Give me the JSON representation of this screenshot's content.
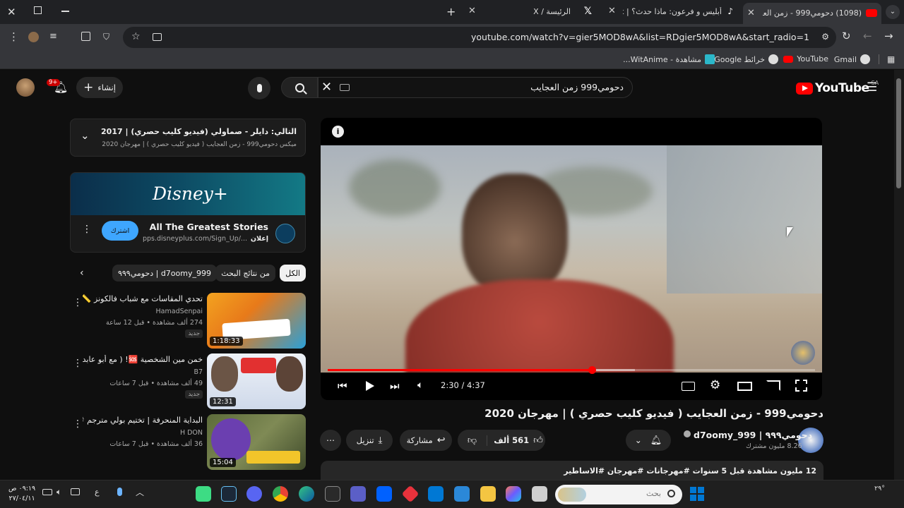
{
  "browser": {
    "tabs": [
      {
        "title": "(1098) دحومي999 - زمن العجايب",
        "active": true
      },
      {
        "title": "أبليس و فرعون: ماذا حدث؟ | TikTok",
        "active": false
      },
      {
        "title": "الرئيسة / X",
        "active": false
      }
    ],
    "url": "youtube.com/watch?v=gier5MOD8wA&list=RDgier5MOD8wA&start_radio=1",
    "bookmarks": [
      "Gmail",
      "YouTube",
      "خرائط Google",
      "مشاهدة - WitAnime..."
    ]
  },
  "youtube": {
    "logo_text": "YouTube",
    "region": "SA",
    "search_query": "دحومي999 زمن العجايب",
    "create_label": "إنشاء",
    "notif_count": "9+"
  },
  "player": {
    "current_time": "2:30",
    "duration": "4:37",
    "progress_fraction": 0.542,
    "buffered_fraction": 0.63
  },
  "video": {
    "title": "دحومي999 - زمن العجايب ( فيديو كليب حصري ) | مهرجان 2020",
    "channel": "d7oomy_999 | دحومي٩٩٩",
    "subscribers": "8.26 مليون مشترك",
    "likes": "561 ألف",
    "share_label": "مشاركة",
    "download_label": "تنزيل",
    "desc_line": "12 مليون مشاهدة  قبل 5 سنوات  #مهرجانات #مهرجان #الاساطير"
  },
  "queue": {
    "next_label": "التالي: دايلر - صماولي (فيديو كليب حصري) | 2017",
    "mix_label": "ميكس دحومي999 - زمن العجايب ( فيديو كليب حصري ) | مهرجان 2020"
  },
  "ad": {
    "brand_text": "Disney+",
    "title": "All The Greatest Stories",
    "sponsored": "إعلان",
    "link": "pps.disneyplus.com/Sign_Up/...",
    "cta": "اشترك"
  },
  "chips": [
    "الكل",
    "من نتائج البحث",
    "d7oomy_999 | دحومي٩٩٩"
  ],
  "recommendations": [
    {
      "title": "تحدي المقاسات مع شباب فالكونز 📏💚",
      "channel": "HamadSenpai",
      "meta": "274 ألف مشاهدة • قبل 12 ساعة",
      "duration": "1:18:33",
      "badge": "جديد"
    },
    {
      "title": "خمن مين الشخصية 🆘! ( مع أبو عابد 🔥 )",
      "channel": "B7",
      "meta": "49 ألف مشاهدة • قبل 7 ساعات",
      "duration": "12:31",
      "badge": "جديد"
    },
    {
      "title": "البداية المنحرفة | تختيم بولي مترجم #1",
      "channel": "H DON",
      "meta": "36 ألف مشاهدة • قبل 7 ساعات",
      "duration": "15:04",
      "badge": "جديد"
    }
  ],
  "taskbar": {
    "search_placeholder": "بحث",
    "time": "٠٩:١٩ ص",
    "date": "٢٧/٠٤/١١",
    "lang": "ع",
    "temp": "٢٩°"
  },
  "colors": {
    "accent": "#ff0000",
    "chip_selected": "#f1f1f1",
    "subscribe": "#3ea6ff"
  }
}
